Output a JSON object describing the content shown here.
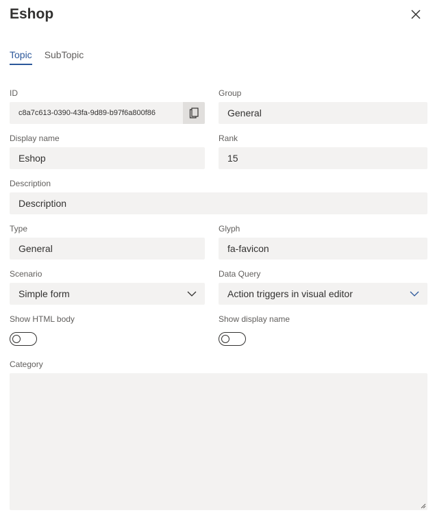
{
  "panel": {
    "title": "Eshop"
  },
  "tabs": [
    {
      "label": "Topic",
      "active": true
    },
    {
      "label": "SubTopic",
      "active": false
    }
  ],
  "fields": {
    "id": {
      "label": "ID",
      "value": "c8a7c613-0390-43fa-9d89-b97f6a800f86"
    },
    "group": {
      "label": "Group",
      "value": "General"
    },
    "display_name": {
      "label": "Display name",
      "value": "Eshop"
    },
    "rank": {
      "label": "Rank",
      "value": "15"
    },
    "description": {
      "label": "Description",
      "placeholder": "Description"
    },
    "type": {
      "label": "Type",
      "value": "General"
    },
    "glyph": {
      "label": "Glyph",
      "value": "fa-favicon"
    },
    "scenario": {
      "label": "Scenario",
      "value": "Simple form"
    },
    "data_query": {
      "label": "Data Query",
      "value": "Action triggers in visual editor"
    },
    "show_html_body": {
      "label": "Show HTML body",
      "on": false
    },
    "show_display_name": {
      "label": "Show display name",
      "on": false
    },
    "category": {
      "label": "Category",
      "value": ""
    }
  },
  "colors": {
    "accent": "#2b579a",
    "field_bg": "#f3f2f1",
    "label": "#605e5c"
  },
  "icons": {
    "close": "close-icon",
    "copy": "copy-icon",
    "chevron": "chevron-down-icon"
  }
}
